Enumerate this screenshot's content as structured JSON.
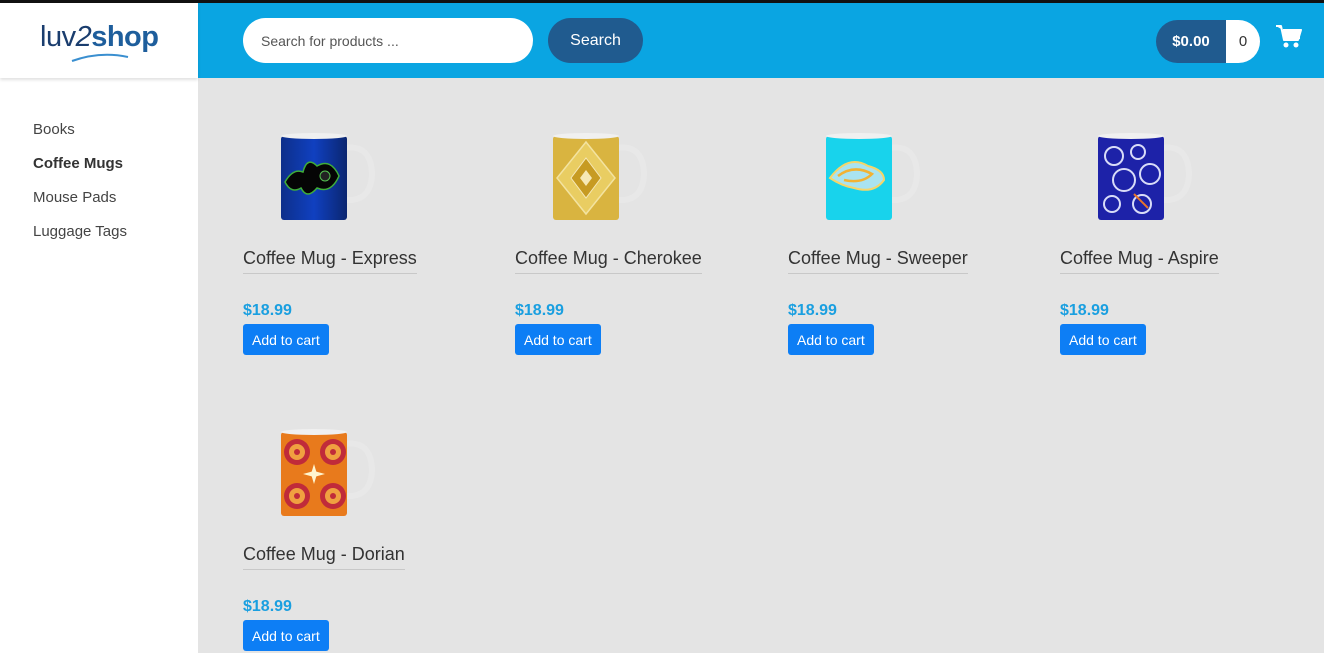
{
  "brand": {
    "logo_luv": "luv",
    "logo_two": "2",
    "logo_shop": "shop"
  },
  "sidebar": {
    "items": [
      {
        "label": "Books",
        "active": false
      },
      {
        "label": "Coffee Mugs",
        "active": true
      },
      {
        "label": "Mouse Pads",
        "active": false
      },
      {
        "label": "Luggage Tags",
        "active": false
      }
    ]
  },
  "search": {
    "placeholder": "Search for products ...",
    "value": "",
    "button_label": "Search"
  },
  "cart": {
    "total": "$0.00",
    "quantity": "0"
  },
  "colors": {
    "header": "#0aa5e2",
    "accent_dark": "#205b8f",
    "price": "#1a9fe0",
    "button": "#0d7ef5"
  },
  "products": [
    {
      "name": "Coffee Mug - Express",
      "price": "$18.99",
      "button_label": "Add to cart",
      "pattern": "mandelbrot-blue"
    },
    {
      "name": "Coffee Mug - Cherokee",
      "price": "$18.99",
      "button_label": "Add to cart",
      "pattern": "gold-diamond"
    },
    {
      "name": "Coffee Mug - Sweeper",
      "price": "$18.99",
      "button_label": "Add to cart",
      "pattern": "cyan-swirl"
    },
    {
      "name": "Coffee Mug - Aspire",
      "price": "$18.99",
      "button_label": "Add to cart",
      "pattern": "blue-lace"
    },
    {
      "name": "Coffee Mug - Dorian",
      "price": "$18.99",
      "button_label": "Add to cart",
      "pattern": "orange-spiral"
    }
  ]
}
